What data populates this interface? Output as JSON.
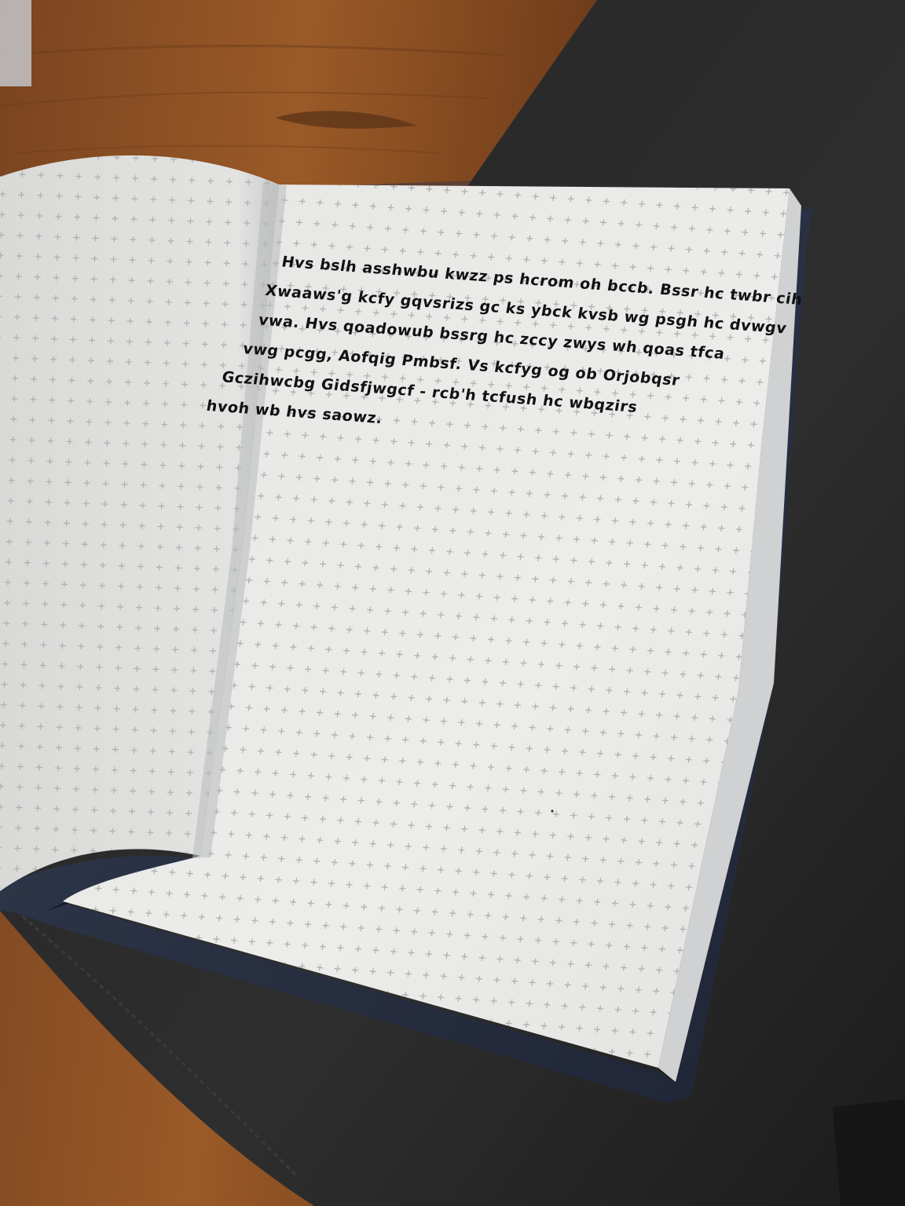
{
  "photo": {
    "colors": {
      "desk_wood": "#8a4f23",
      "desk_wood_dark": "#5a3317",
      "fabric_mat": "#2a2a2a",
      "fabric_mat_dark": "#1a1a1a",
      "floor_wood": "#5a3e32",
      "notebook_cover": "#2b3346",
      "page_paper": "#ececea",
      "grid_mark": "#a7aaa8",
      "ink": "#111111"
    }
  },
  "notebook": {
    "right_page": {
      "handwritten_lines": [
        "Hvs bslh asshwbu kwzz ps hcrom oh bccb. Bssr hc twbr cih",
        "Xwaaws'g kcfy gqvsrizs gc ks ybck kvsb wg psgh hc dvwgv",
        "vwa. Hvs qoadowub bssrg hc zccy zwys wh qoas tfca",
        "vwg pcgg, Aofqig Pmbsf. Vs kcfyg og ob Orjobqsr",
        "Gczihwcbg Gidsfjwgcf - rcb'h tcfush hc wbqzirs",
        "hvoh wb hvs saowz."
      ]
    }
  }
}
